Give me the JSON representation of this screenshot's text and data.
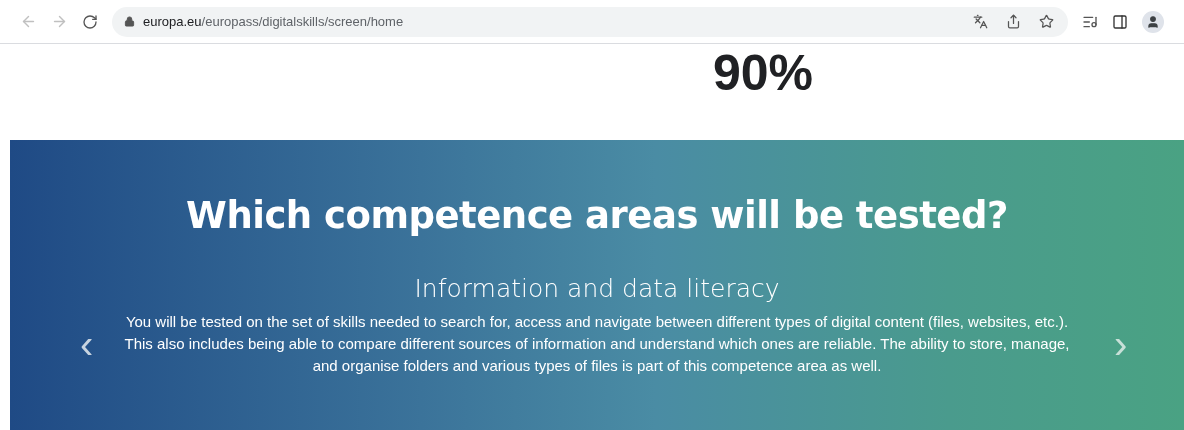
{
  "browser": {
    "url_domain": "europa.eu",
    "url_path": "/europass/digitalskills/screen/home"
  },
  "stat": {
    "value": "90%"
  },
  "banner": {
    "title": "Which competence areas will be tested?",
    "slide": {
      "heading": "Information and data literacy",
      "text": "You will be tested on the set of skills needed to search for, access and navigate between different types of digital content (files, websites, etc.). This also includes being able to compare different sources of information and understand which ones are reliable. The ability to store, manage, and organise folders and various types of files is part of this competence area as well."
    },
    "prev": "‹",
    "next": "›"
  }
}
